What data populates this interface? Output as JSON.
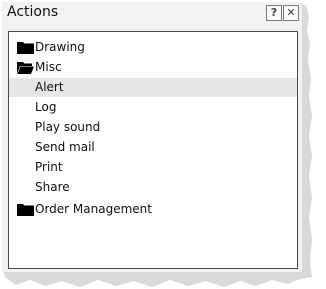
{
  "window": {
    "title": "Actions",
    "help_glyph": "?",
    "close_glyph": "✕"
  },
  "tree": {
    "folders": [
      {
        "label": "Drawing",
        "expanded": false
      },
      {
        "label": "Misc",
        "expanded": true
      },
      {
        "label": "Order Management",
        "expanded": false
      }
    ],
    "misc_items": [
      {
        "label": "Alert",
        "selected": true
      },
      {
        "label": "Log",
        "selected": false
      },
      {
        "label": "Play sound",
        "selected": false
      },
      {
        "label": "Send mail",
        "selected": false
      },
      {
        "label": "Print",
        "selected": false
      },
      {
        "label": "Share",
        "selected": false
      }
    ]
  },
  "icons": {
    "folder_closed": "folder-closed-icon",
    "folder_open": "folder-open-icon",
    "help": "help-icon",
    "close": "close-icon"
  },
  "colors": {
    "selection": "#e6e6e6",
    "border": "#4a4a4a"
  }
}
